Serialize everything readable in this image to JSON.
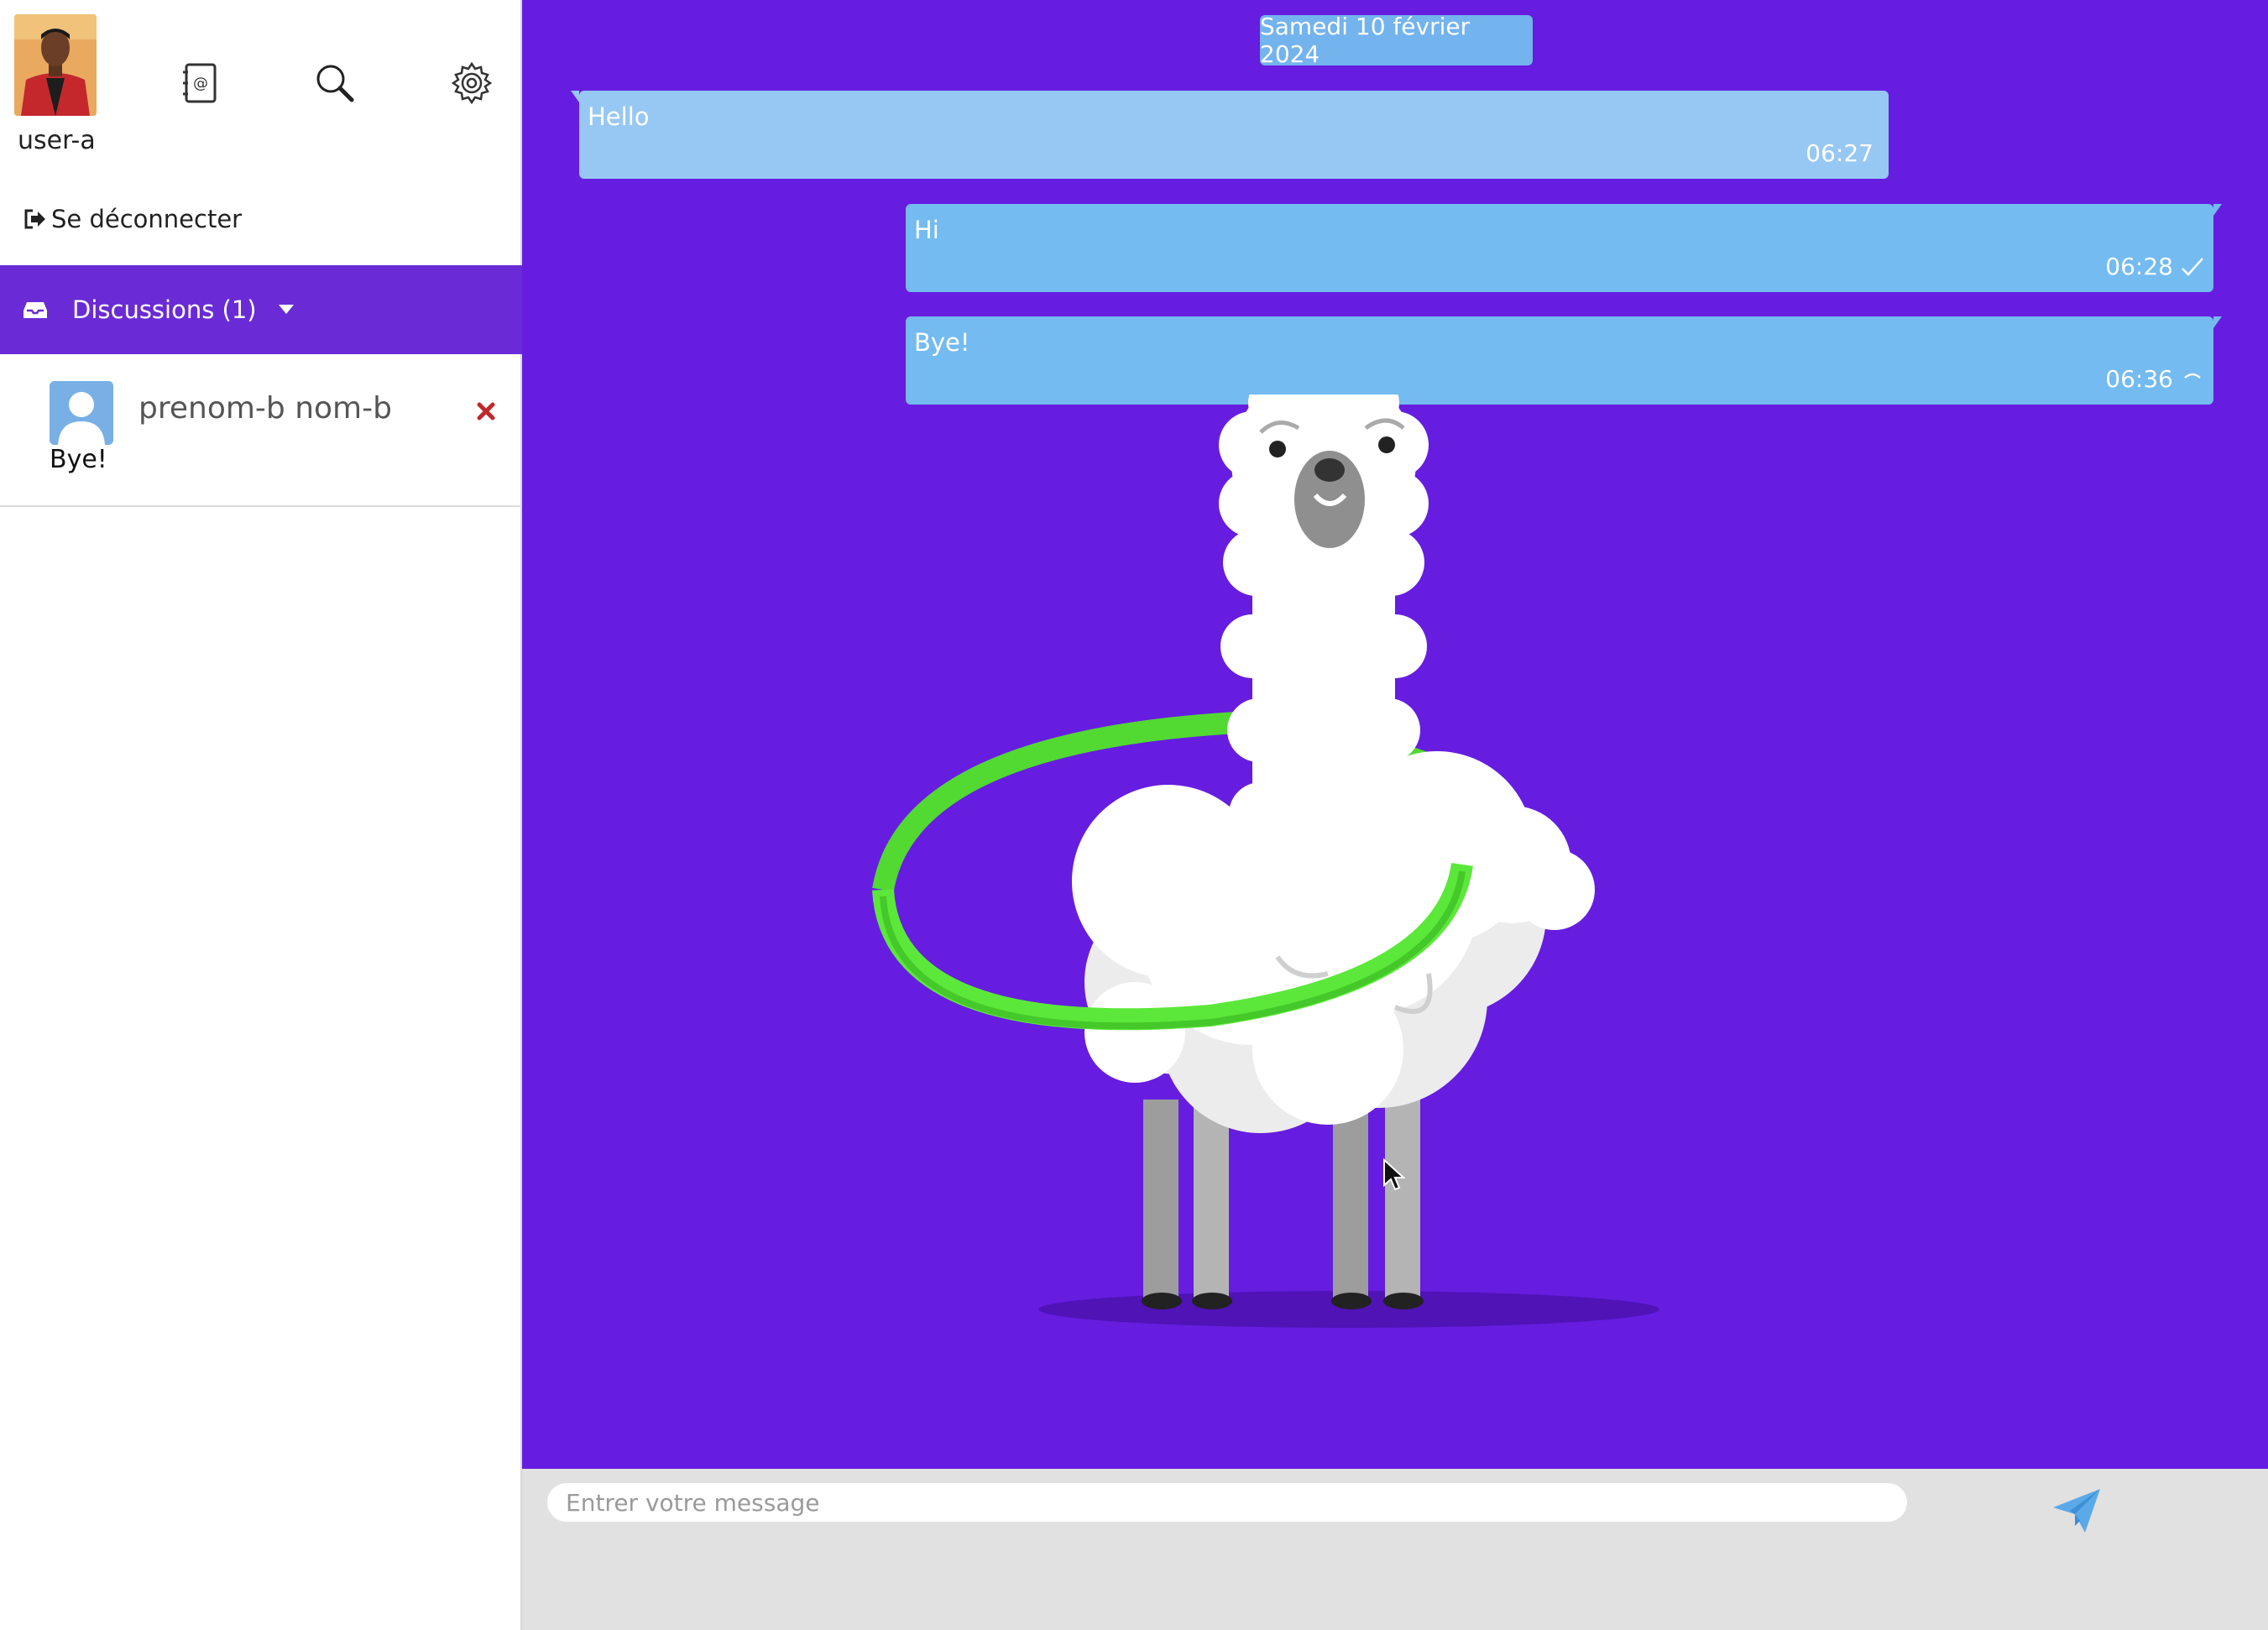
{
  "user": {
    "username": "user-a",
    "logout_label": "Se déconnecter"
  },
  "header_icons": {
    "contacts": "address-book-icon",
    "search": "search-icon",
    "settings": "gear-icon"
  },
  "discussions": {
    "label": "Discussions (1)",
    "items": [
      {
        "name": "prenom-b nom-b",
        "last_message": "Bye!"
      }
    ]
  },
  "chat": {
    "date": "Samedi 10 février 2024",
    "messages": [
      {
        "text": "Hello",
        "time": "06:27",
        "direction": "incoming"
      },
      {
        "text": "Hi",
        "time": "06:28",
        "direction": "outgoing",
        "status": "check-icon"
      },
      {
        "text": "Bye!",
        "time": "06:36",
        "direction": "outgoing",
        "status": "pending-icon"
      }
    ]
  },
  "composer": {
    "placeholder": "Entrer votre message",
    "value": ""
  },
  "colors": {
    "accent": "#6a2bd6",
    "chat_background": "#661de0",
    "incoming_bubble": "#97c8f3",
    "outgoing_bubble": "#73bbf0",
    "hoop": "#5ce83a"
  }
}
